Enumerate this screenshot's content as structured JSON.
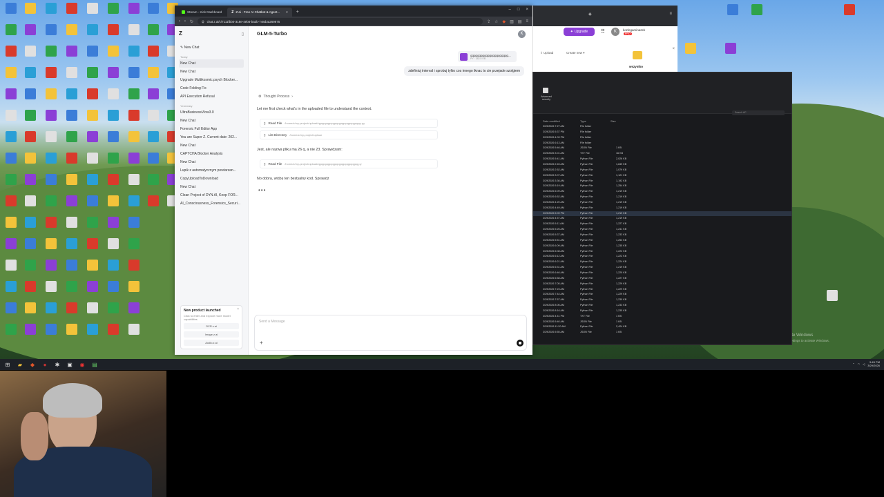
{
  "browser": {
    "tabs": [
      {
        "label": "Stream - Kick Dashboard",
        "active": false
      },
      {
        "label": "Z.ai - Free AI Chatbot & Agent...",
        "active": true
      }
    ],
    "url": "chat.z.ai/c/7111fbb0-318e-4eb6-ba3b-748d3a269875"
  },
  "sidebar": {
    "logo": "Z",
    "new_chat": "New Chat",
    "today_label": "Today",
    "today_items": [
      "New Chat",
      "New Chat",
      "Upgrade Multikosmic.psych Blocker...",
      "Code Folding Fix",
      "API Execution Refusal"
    ],
    "yesterday_label": "Yesterday",
    "older_items": [
      "UltraBusinessVlow3.0",
      "New Chat",
      "Forensic Full Editor App",
      "You are Super Z. Current date: 202...",
      "New Chat",
      "CAPTCHA Blocker Analysis",
      "New Chat",
      "Lupik z automatycznym powtarzan...",
      "CopyUploadToDownload",
      "New Chat",
      "Clean Project of DYN AI, Keep FOR...",
      "AI_Consciousness_Forensics_Securi..."
    ],
    "promo": {
      "title": "New product launched",
      "desc": "Click to enter and explore more model capabilities",
      "links": [
        "OCR.z.ai",
        "Image.z.ai",
        "Audio.z.ai"
      ]
    }
  },
  "chat": {
    "model": "GLM-5-Turbo",
    "avatar": "K",
    "attachment_name": "qqqqqqqqqqqqqqqqqqqqqq...",
    "attachment_size": "PY · 182.0 KB",
    "user_message": "zdefiniuj interval i sprobuj tylko cos innego tknac to cie przejade szolgiem",
    "thought_label": "Thought Process",
    "para1": "Let me first check what's in the uploaded file to understand the context.",
    "tool1": {
      "action": "Read File",
      "path": "/home/z/my-project/upload/qqqqqqqqqqqqqqqqqqqqqqqqqqqq.py"
    },
    "tool2": {
      "action": "List Directory",
      "path": "/home/z/my-project/upload"
    },
    "para2": "Jest, ale nazwa pliku ma 26 q, a nie 23. Sprawdzam:",
    "tool3": {
      "action": "Read File",
      "path": "/home/z/my-project/upload/qqqqqqqqqqqqqqqqqqqqqqqqqq.py"
    },
    "para3": "No dobra, widzę ten bestyalny kod. Sprawdz",
    "typing": "•••",
    "input_placeholder": "Send a Message"
  },
  "browser2": {
    "upgrade_label": "Upgrade",
    "user": "kozlegaminazek",
    "badge": "PRO",
    "upload": "Upload",
    "create_new": "Create new",
    "folder_label": "wszystko"
  },
  "explorer": {
    "security_label": "Advanced security",
    "search_placeholder": "Search AP",
    "columns": [
      "Date modified",
      "Type",
      "Size"
    ],
    "rows": [
      [
        "3/29/2026 7:27 AM",
        "File folder",
        ""
      ],
      [
        "3/29/2026 5:37 PM",
        "File folder",
        ""
      ],
      [
        "3/29/2026 4:03 PM",
        "File folder",
        ""
      ],
      [
        "3/29/2026 6:13 AM",
        "File folder",
        ""
      ],
      [
        "3/29/2026 5:46 AM",
        "JSON File",
        "1 KB"
      ],
      [
        "3/29/2026 3:01 AM",
        "TXT File",
        "16 KB"
      ],
      [
        "3/29/2026 5:41 AM",
        "Python File",
        "2,026 KB"
      ],
      [
        "3/29/2026 2:45 AM",
        "Python File",
        "1,849 KB"
      ],
      [
        "3/29/2026 2:52 AM",
        "Python File",
        "1,079 KB"
      ],
      [
        "3/29/2026 3:07 AM",
        "Python File",
        "1,121 KB"
      ],
      [
        "3/29/2026 3:36 AM",
        "Python File",
        "1,192 KB"
      ],
      [
        "3/29/2026 5:19 AM",
        "Python File",
        "1,254 KB"
      ],
      [
        "3/29/2026 6:09 AM",
        "Python File",
        "1,219 KB"
      ],
      [
        "3/29/2026 6:52 AM",
        "Python File",
        "1,219 KB"
      ],
      [
        "3/29/2026 4:20 AM",
        "Python File",
        "1,219 KB"
      ],
      [
        "3/29/2026 4:49 AM",
        "Python File",
        "1,219 KB"
      ],
      [
        "3/29/2026 5:09 PM",
        "Python File",
        "1,219 KB"
      ],
      [
        "3/29/2026 4:57 AM",
        "Python File",
        "1,219 KB"
      ],
      [
        "3/29/2026 5:11 AM",
        "Python File",
        "1,227 KB"
      ],
      [
        "3/29/2026 5:26 AM",
        "Python File",
        "1,241 KB"
      ],
      [
        "3/29/2026 5:37 AM",
        "Python File",
        "1,233 KB"
      ],
      [
        "3/29/2026 5:51 AM",
        "Python File",
        "1,253 KB"
      ],
      [
        "3/29/2026 6:09 AM",
        "Python File",
        "1,235 KB"
      ],
      [
        "3/29/2026 6:08 AM",
        "Python File",
        "1,222 KB"
      ],
      [
        "3/29/2026 6:12 AM",
        "Python File",
        "1,222 KB"
      ],
      [
        "3/29/2026 6:21 AM",
        "Python File",
        "1,224 KB"
      ],
      [
        "3/29/2026 6:31 AM",
        "Python File",
        "1,219 KB"
      ],
      [
        "3/29/2026 6:46 AM",
        "Python File",
        "1,220 KB"
      ],
      [
        "3/29/2026 6:58 AM",
        "Python File",
        "1,227 KB"
      ],
      [
        "3/29/2026 7:05 AM",
        "Python File",
        "1,229 KB"
      ],
      [
        "3/29/2026 7:23 AM",
        "Python File",
        "1,229 KB"
      ],
      [
        "3/29/2026 7:44 AM",
        "Python File",
        "1,229 KB"
      ],
      [
        "3/29/2026 7:57 AM",
        "Python File",
        "1,230 KB"
      ],
      [
        "3/29/2026 8:06 AM",
        "Python File",
        "1,233 KB"
      ],
      [
        "3/29/2026 8:16 AM",
        "Python File",
        "1,235 KB"
      ],
      [
        "3/29/2026 4:41 PM",
        "TXT File",
        "1 KB"
      ],
      [
        "3/29/2026 5:40 AM",
        "JSON File",
        "1 KB"
      ],
      [
        "3/29/2026 11:20 AM",
        "Python File",
        "2,424 KB"
      ],
      [
        "3/29/2026 5:55 AM",
        "JSON File",
        "1 KB"
      ]
    ]
  },
  "desktop": {
    "activate_line1": "Activate Windows",
    "activate_line2": "Go to Settings to activate Windows."
  },
  "taskbar": {
    "time": "5:45 PM",
    "date": "3/29/2026"
  },
  "colors": {
    "accent_purple": "#8b3fd6",
    "browser_chrome": "#24262b",
    "explorer_bg": "#191a1d"
  }
}
